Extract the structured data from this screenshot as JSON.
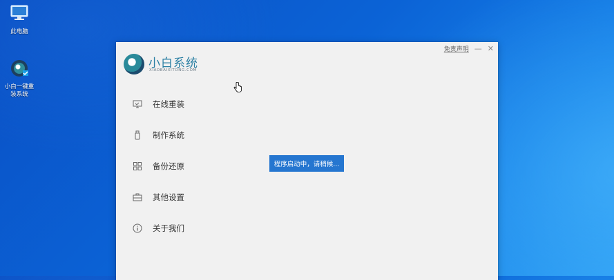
{
  "desktop": {
    "icons": [
      {
        "label": "此电脑"
      },
      {
        "label": "小白一键重\n装系统"
      }
    ]
  },
  "app": {
    "logo": {
      "title": "小白系统",
      "subtitle": "XIAOBAIXITONG.COM"
    },
    "top": {
      "disclaimer": "免责声明",
      "minimize": "—",
      "close": "✕"
    },
    "nav": [
      {
        "label": "在线重装",
        "icon": "monitor-icon"
      },
      {
        "label": "制作系统",
        "icon": "usb-drive-icon"
      },
      {
        "label": "备份还原",
        "icon": "backup-grid-icon"
      },
      {
        "label": "其他设置",
        "icon": "toolbox-icon"
      },
      {
        "label": "关于我们",
        "icon": "info-icon"
      }
    ],
    "status": "程序启动中，请稍候..."
  },
  "colors": {
    "accent": "#2576d0",
    "logo": "#2a7fa3",
    "window_bg": "#f1f1f1"
  }
}
